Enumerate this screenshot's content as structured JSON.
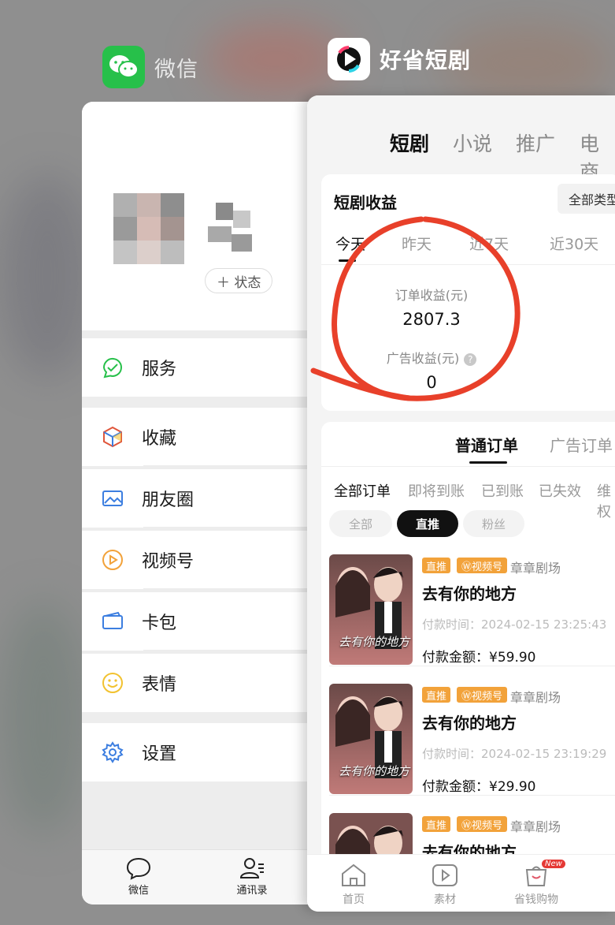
{
  "colors": {
    "wechat_green": "#27c04a",
    "accent_orange": "#f2a23a",
    "annotation_red": "#e8402a"
  },
  "switcher": {
    "wechat": {
      "app_name": "微信",
      "icon": "wechat-logo-icon"
    },
    "haosheng": {
      "app_name": "好省短剧",
      "icon": "play-logo-icon"
    }
  },
  "wechat": {
    "status_chip": "＋ 状态",
    "menu": [
      {
        "label": "服务",
        "icon": "service-icon"
      },
      {
        "label": "收藏",
        "icon": "favorites-cube-icon"
      },
      {
        "label": "朋友圈",
        "icon": "moments-image-icon"
      },
      {
        "label": "视频号",
        "icon": "channels-play-icon"
      },
      {
        "label": "卡包",
        "icon": "card-wallet-icon"
      },
      {
        "label": "表情",
        "icon": "smiley-icon"
      },
      {
        "label": "设置",
        "icon": "gear-icon"
      }
    ],
    "tabbar": [
      {
        "label": "微信",
        "icon": "chat-bubble-icon"
      },
      {
        "label": "通讯录",
        "icon": "contacts-icon"
      }
    ]
  },
  "haosheng": {
    "top_tabs": [
      "短剧",
      "小说",
      "推广",
      "电商"
    ],
    "earnings": {
      "title": "短剧收益",
      "type_button": "全部类型",
      "periods": [
        "今天",
        "昨天",
        "近7天",
        "近30天"
      ],
      "order_income_label": "订单收益(元)",
      "order_income_value": "2807.3",
      "ad_income_label": "广告收益(元)",
      "ad_income_value": "0"
    },
    "order_tabs": [
      "普通订单",
      "广告订单"
    ],
    "filters": [
      "全部订单",
      "即将到账",
      "已到账",
      "已失效",
      "维权"
    ],
    "pills": [
      "全部",
      "直推",
      "粉丝"
    ],
    "orders": [
      {
        "badge": "直推",
        "channel": "视频号",
        "source": "章章剧场",
        "title": "去有你的地方",
        "pay_time": "付款时间：2024-02-15 23:25:43",
        "amount": "付款金额：¥59.90",
        "poster_text": "去有你的地方"
      },
      {
        "badge": "直推",
        "channel": "视频号",
        "source": "章章剧场",
        "title": "去有你的地方",
        "pay_time": "付款时间：2024-02-15 23:19:29",
        "amount": "付款金额：¥29.90",
        "poster_text": "去有你的地方"
      },
      {
        "badge": "直推",
        "channel": "视频号",
        "source": "章章剧场",
        "title": "去有你的地方"
      }
    ],
    "tabbar": [
      {
        "label": "首页",
        "icon": "home-icon"
      },
      {
        "label": "素材",
        "icon": "material-play-icon"
      },
      {
        "label": "省钱购物",
        "icon": "shopping-bag-icon",
        "badge": "New"
      }
    ]
  }
}
